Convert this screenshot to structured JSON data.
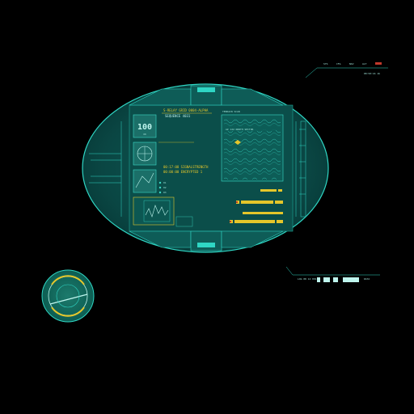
{
  "colors": {
    "background": "#000000",
    "panel_fill": "#0b4a47",
    "panel_edge": "#2fd6c4",
    "accent_yellow": "#e5c62a",
    "accent_red": "#c0392b"
  },
  "main_panel": {
    "widget_top_value": "100",
    "widget_top_caption": "OK",
    "header_text_1": "S-RELAY GRID 0004-ALPHA",
    "status_line_1": "SEQUENCE 4031",
    "status_line_2": "00:17:08 SIGNALSTRENGTH",
    "status_line_3": "00:00:00 ENCRYPTED 1",
    "map_title": "TERRAIN SCAN",
    "map_label": "AZ 122 NORTH SECTOR",
    "legend_items": [
      "01",
      "02",
      "03"
    ],
    "icons": [
      "gauge-icon",
      "waveform-icon",
      "terrain-map-icon",
      "marker-icon"
    ]
  },
  "top_right_readout": {
    "line_1": [
      "SYS",
      "CFG",
      "NAV",
      "ALT"
    ],
    "line_2": "08:50:16 16"
  },
  "bottom_right_readout": {
    "line_1": "LOG  08 14 001",
    "line_2": "DATA"
  },
  "small_dial": {
    "icon": "radar-dial-icon"
  }
}
